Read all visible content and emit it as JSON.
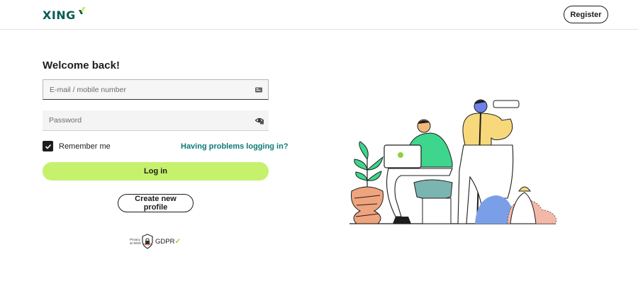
{
  "header": {
    "logo_text": "XING",
    "register_label": "Register"
  },
  "login": {
    "title": "Welcome back!",
    "email_placeholder": "E-mail / mobile number",
    "password_placeholder": "Password",
    "remember_label": "Remember me",
    "remember_checked": true,
    "problems_link": "Having problems logging in?",
    "login_label": "Log in",
    "create_label": "Create new profile"
  },
  "gdpr": {
    "small_text_1": "Privacy",
    "small_text_2": "at XING",
    "label": "GDPR",
    "check": "✓"
  },
  "colors": {
    "brand": "#0a5a55",
    "brand_accent": "#c6f16d",
    "link": "#0a7a76"
  }
}
